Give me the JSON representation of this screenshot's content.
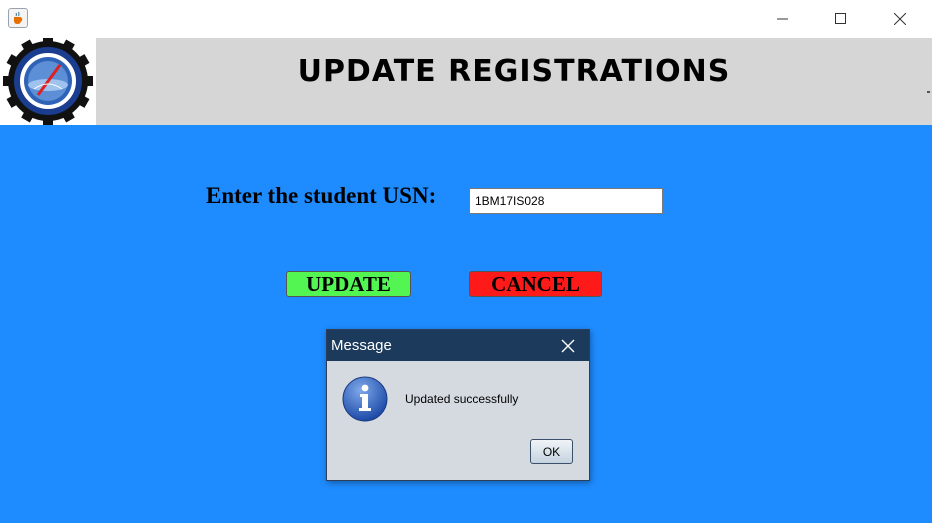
{
  "window": {
    "icon": "java-cup-icon",
    "controls": [
      "minimize-icon",
      "maximize-icon",
      "close-icon"
    ]
  },
  "header": {
    "title": "UPDATE REGISTRATIONS",
    "background": "#d6d6d6",
    "logo": "college-seal-logo"
  },
  "form": {
    "usn_label": "Enter the student USN:",
    "usn_value": "1BM17IS028",
    "background": "#1e8cff"
  },
  "buttons": {
    "update_label": "UPDATE",
    "cancel_label": "CANCEL",
    "update_color": "#52f552",
    "cancel_color": "#ff1a1a"
  },
  "dialog": {
    "title": "Message",
    "message": "Updated successfully",
    "ok_label": "OK",
    "icon": "info-icon",
    "title_color": "#1b3a5c"
  }
}
